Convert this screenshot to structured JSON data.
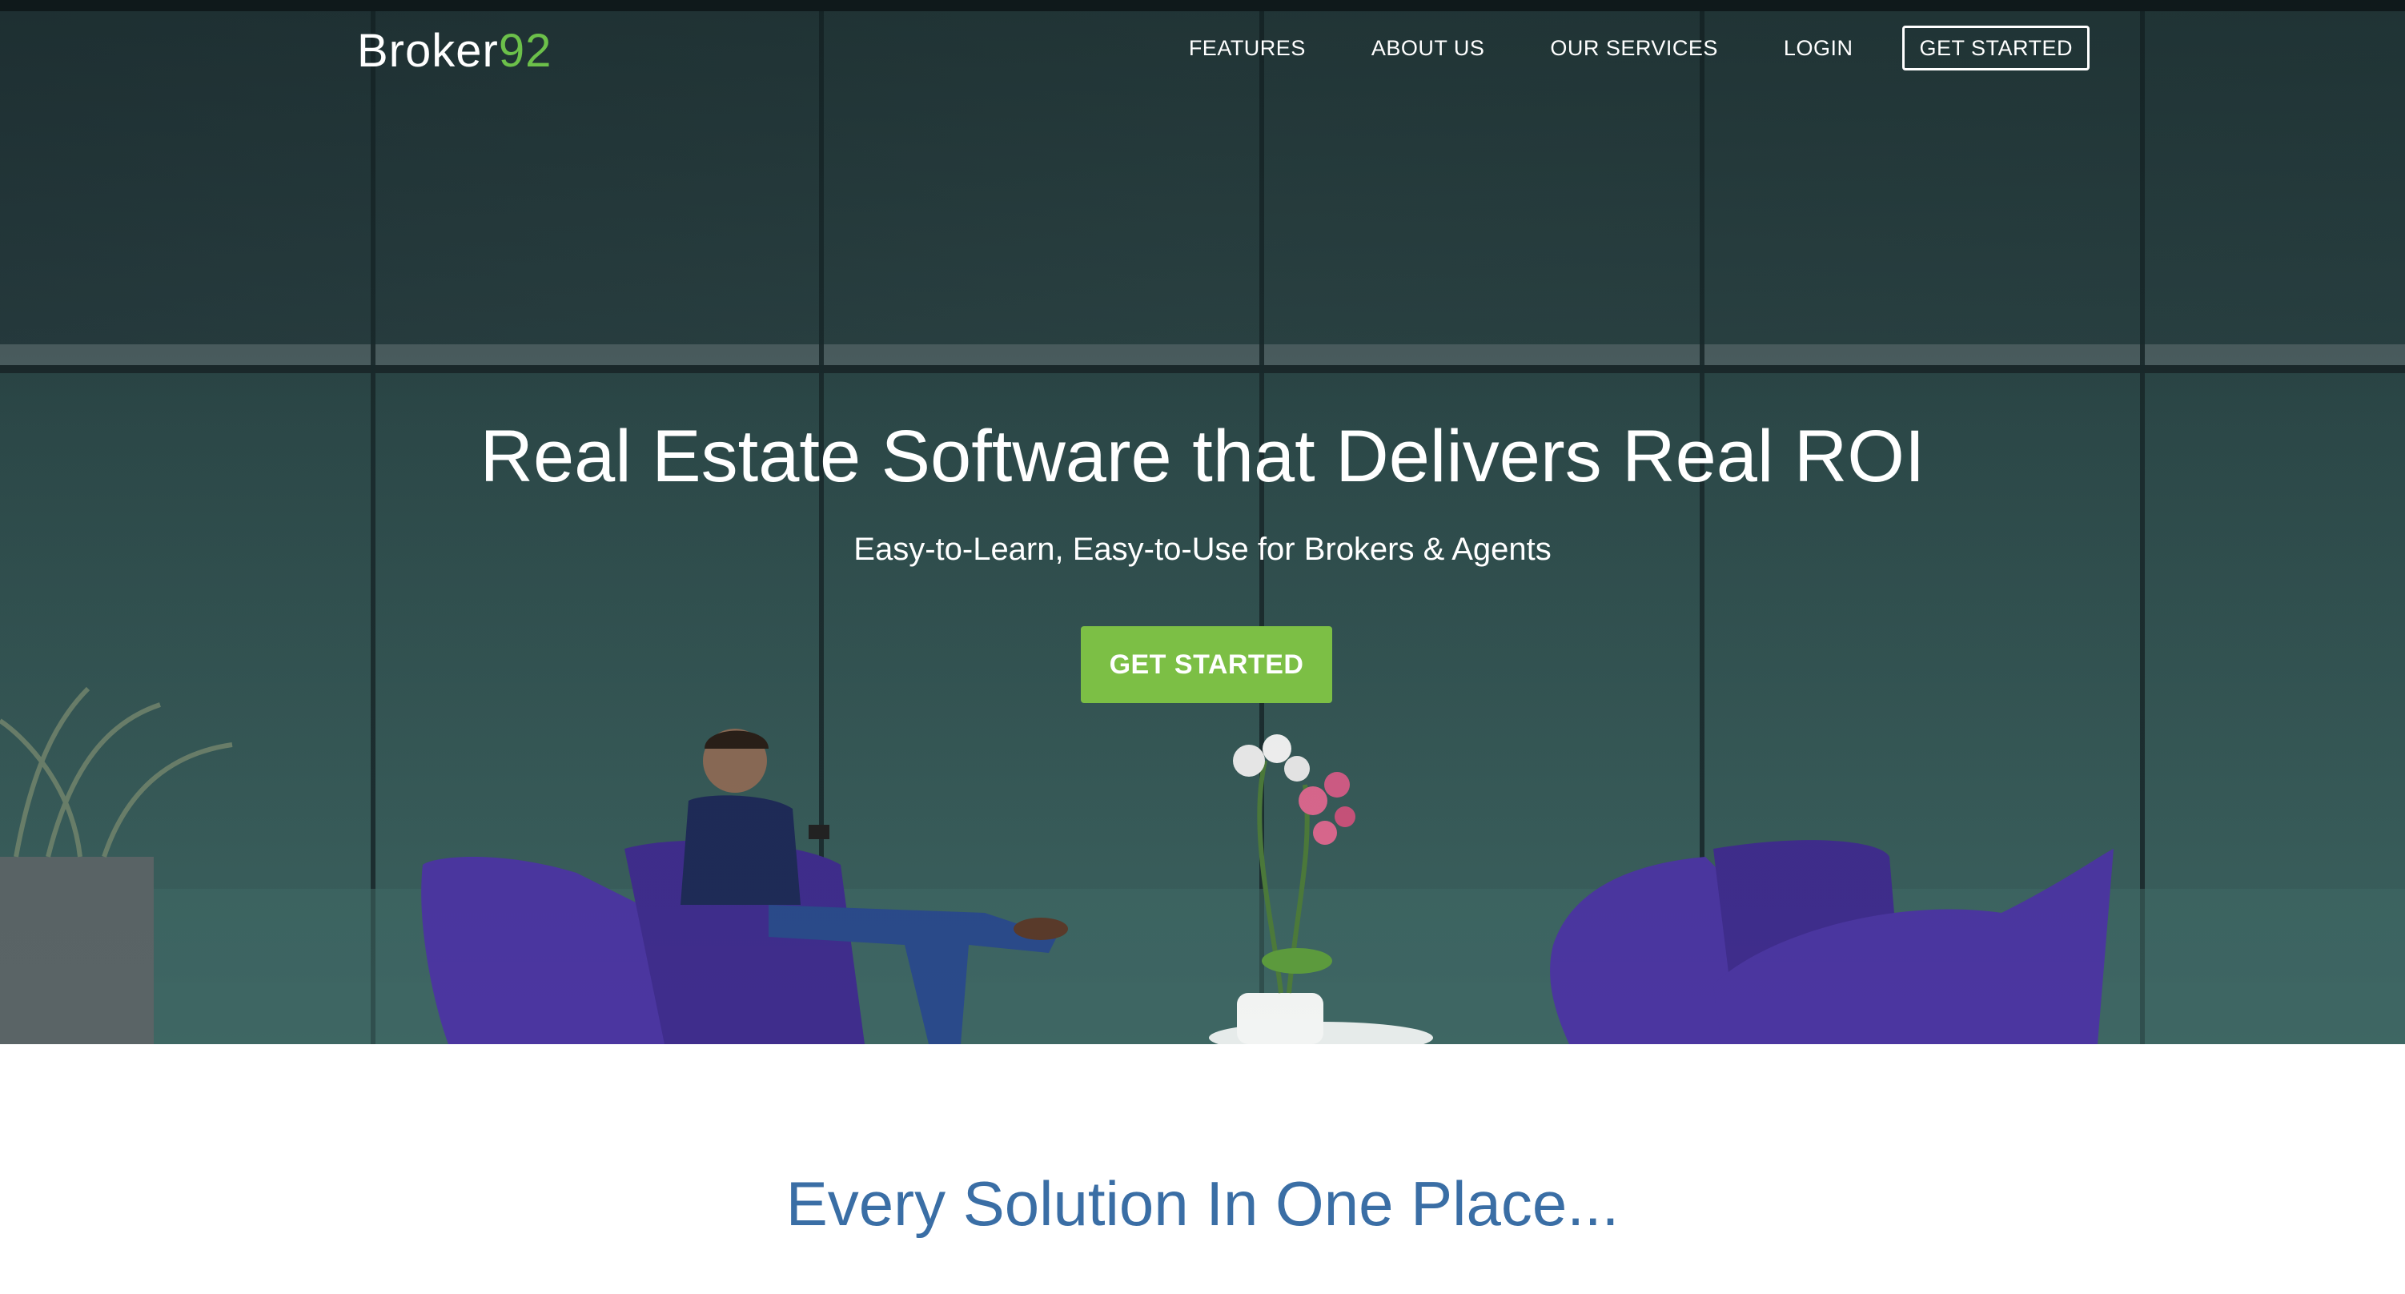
{
  "nav": {
    "logo_text": "Broker",
    "logo_accent": "92",
    "links": [
      {
        "label": "FEATURES"
      },
      {
        "label": "ABOUT US"
      },
      {
        "label": "OUR SERVICES"
      },
      {
        "label": "LOGIN"
      }
    ],
    "cta_label": "GET STARTED"
  },
  "hero": {
    "title": "Real Estate Software that Delivers Real ROI",
    "subtitle": "Easy-to-Learn, Easy-to-Use for Brokers & Agents",
    "cta_label": "GET STARTED"
  },
  "section": {
    "title": "Every Solution In One Place..."
  },
  "colors": {
    "accent_green": "#7cbf45",
    "logo_green": "#6cc04a",
    "section_title_blue": "#3a6ea5",
    "hero_dark": "#2d4b4c"
  }
}
